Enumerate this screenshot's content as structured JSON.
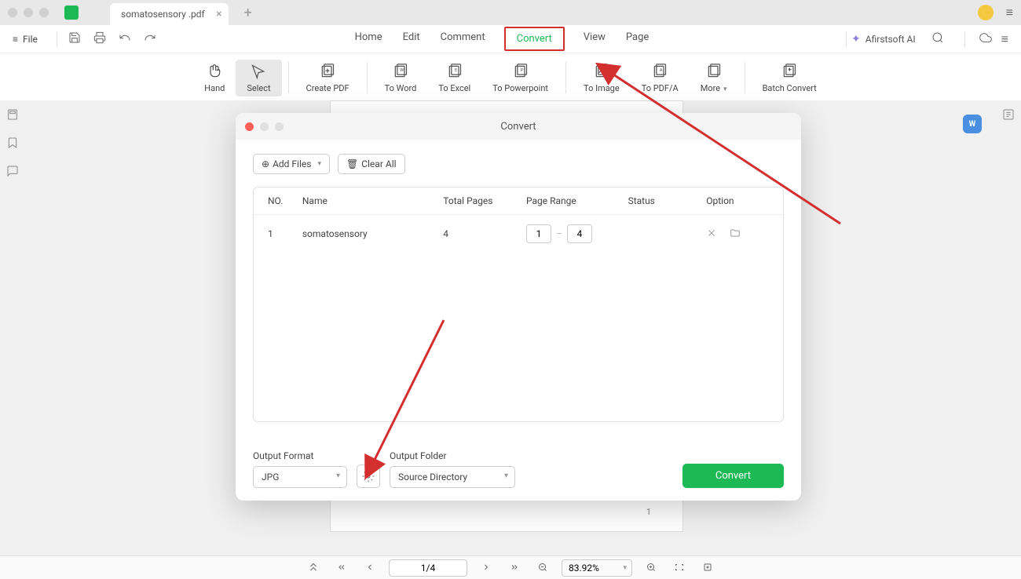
{
  "titlebar": {
    "tab_name": "somatosensory .pdf"
  },
  "menubar": {
    "file": "File",
    "items": [
      "Home",
      "Edit",
      "Comment",
      "Convert",
      "View",
      "Page"
    ],
    "active_index": 3,
    "ai_label": "Afirstsoft AI"
  },
  "ribbon": {
    "items": [
      {
        "label": "Hand"
      },
      {
        "label": "Select"
      },
      {
        "label": "Create PDF"
      },
      {
        "label": "To Word"
      },
      {
        "label": "To Excel"
      },
      {
        "label": "To Powerpoint"
      },
      {
        "label": "To Image"
      },
      {
        "label": "To PDF/A"
      },
      {
        "label": "More"
      },
      {
        "label": "Batch Convert"
      }
    ],
    "selected_index": 1
  },
  "dialog": {
    "title": "Convert",
    "add_files": "Add Files",
    "clear_all": "Clear All",
    "columns": {
      "no": "NO.",
      "name": "Name",
      "total": "Total Pages",
      "range": "Page Range",
      "status": "Status",
      "option": "Option"
    },
    "rows": [
      {
        "no": "1",
        "name": "somatosensory",
        "total": "4",
        "from": "1",
        "to": "4",
        "status": ""
      }
    ],
    "output_format_label": "Output Format",
    "output_format_value": "JPG",
    "output_folder_label": "Output Folder",
    "output_folder_value": "Source Directory",
    "convert_btn": "Convert"
  },
  "statusbar": {
    "page": "1/4",
    "zoom": "83.92%"
  },
  "page_number_tag": "1"
}
